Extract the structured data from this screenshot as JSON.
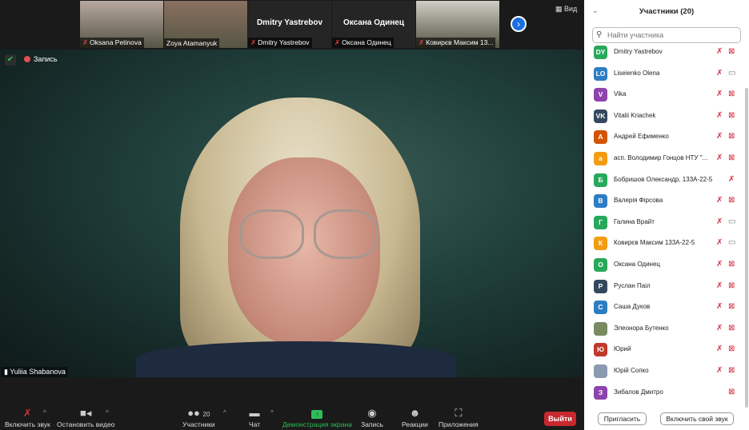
{
  "strip": {
    "thumbs": [
      {
        "name": "Oksana Petinova",
        "video": true,
        "muted": true,
        "bg": "#b8a8a0"
      },
      {
        "name": "Zoya Atamanyuk",
        "video": true,
        "muted": false,
        "bg": "#8a7060"
      },
      {
        "name": "Dmitry Yastrebov",
        "title": "Dmitry Yastrebov",
        "video": false,
        "muted": true
      },
      {
        "name": "Оксана Одинец",
        "title": "Оксана Одинец",
        "video": false,
        "muted": true
      },
      {
        "name": "Ковирєв Максим 13...",
        "video": true,
        "muted": true,
        "bg": "#d0ccc4"
      }
    ],
    "view_label": "Вид"
  },
  "video": {
    "speaker": "Yuliia Shabanova",
    "recording_label": "Запись"
  },
  "toolbar": {
    "unmute": "Включить звук",
    "stop_video": "Остановить видео",
    "participants": "Участники",
    "participants_count": "20",
    "chat": "Чат",
    "share": "Демонстрация экрана",
    "record": "Запись",
    "reactions": "Реакции",
    "apps": "Приложения",
    "leave": "Выйти"
  },
  "panel": {
    "title": "Участники (20)",
    "search_placeholder": "Найти участника",
    "invite": "Пригласить",
    "unmute_self": "Включить свой звук",
    "participants": [
      {
        "initials": "DY",
        "name": "Dmitry Yastrebov",
        "color": "#27a85a",
        "mic": true,
        "cam": "off"
      },
      {
        "initials": "LO",
        "name": "Liseienko Olena",
        "color": "#2d7dc4",
        "mic": true,
        "cam": "on"
      },
      {
        "initials": "V",
        "name": "Vika",
        "color": "#8e44ad",
        "mic": true,
        "cam": "off"
      },
      {
        "initials": "VK",
        "name": "Vitalii Kriachek",
        "color": "#34495e",
        "mic": true,
        "cam": "off"
      },
      {
        "initials": "A",
        "name": "Андрей Ефименко",
        "color": "#d35400",
        "mic": true,
        "cam": "off"
      },
      {
        "initials": "a",
        "name": "асп. Володимир Гонцов НТУ \"...",
        "color": "#f39c12",
        "mic": true,
        "cam": "off"
      },
      {
        "initials": "Б",
        "name": "Бобришов Олександр, 133А-22-5",
        "color": "#27a85a",
        "mic": true,
        "cam": "none"
      },
      {
        "initials": "В",
        "name": "Валерія Фірсова",
        "color": "#2d7dc4",
        "mic": true,
        "cam": "off"
      },
      {
        "initials": "Г",
        "name": "Галина Врайт",
        "color": "#27a85a",
        "mic": true,
        "cam": "on"
      },
      {
        "initials": "К",
        "name": "Ковирєв Максим 133А-22-5",
        "color": "#f39c12",
        "mic": true,
        "cam": "on"
      },
      {
        "initials": "О",
        "name": "Оксана Одинец",
        "color": "#27a85a",
        "mic": true,
        "cam": "off"
      },
      {
        "initials": "Р",
        "name": "Руслан Паіл",
        "color": "#34495e",
        "mic": true,
        "cam": "off"
      },
      {
        "initials": "С",
        "name": "Саша Дуков",
        "color": "#2d7dc4",
        "mic": true,
        "cam": "off"
      },
      {
        "initials": "",
        "name": "Элеонора Бутенко",
        "color": "#7a8a60",
        "mic": true,
        "cam": "off"
      },
      {
        "initials": "Ю",
        "name": "Юрий",
        "color": "#c0392b",
        "mic": true,
        "cam": "off"
      },
      {
        "initials": "",
        "name": "Юрій Сопко",
        "color": "#8a9ab0",
        "mic": true,
        "cam": "off"
      },
      {
        "initials": "З",
        "name": "Зибалов Дмитро",
        "color": "#8e44ad",
        "mic": false,
        "cam": "off"
      }
    ]
  }
}
